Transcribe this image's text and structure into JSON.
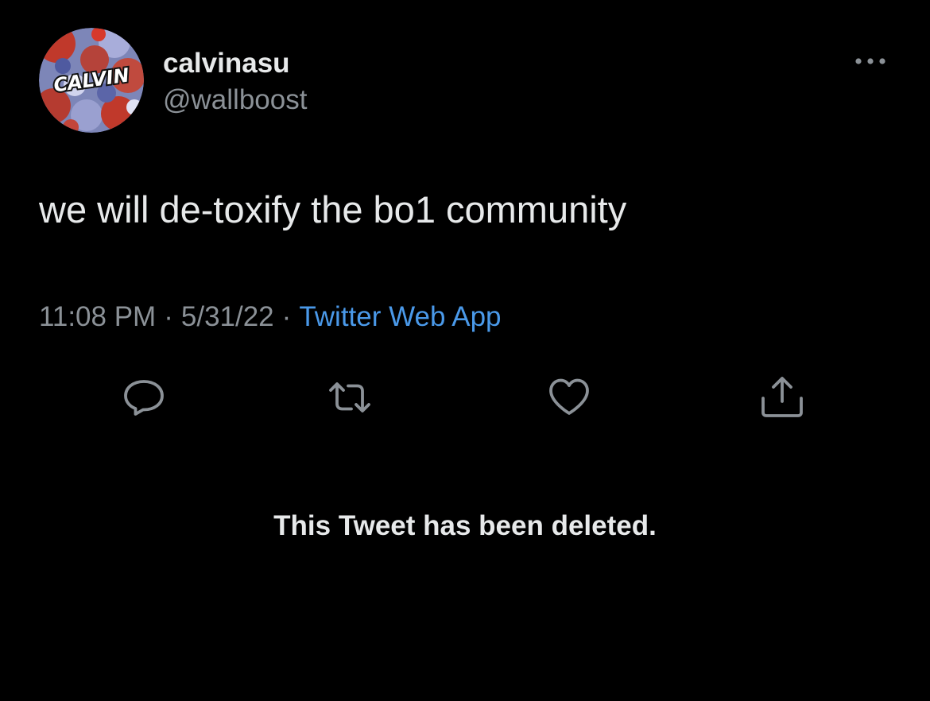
{
  "tweet": {
    "avatar": {
      "icon": "calvin-logo-avatar",
      "logo_text": "CALVIN"
    },
    "display_name": "calvinasu",
    "handle": "@wallboost",
    "text": "we will de-toxify the bo1 community",
    "time": "11:08 PM",
    "date": "5/31/22",
    "separator": "·",
    "source": "Twitter Web App"
  },
  "actions": [
    {
      "name": "reply",
      "icon": "reply-bubble-icon"
    },
    {
      "name": "retweet",
      "icon": "retweet-icon"
    },
    {
      "name": "like",
      "icon": "heart-icon"
    },
    {
      "name": "share",
      "icon": "share-icon"
    }
  ],
  "more_menu": {
    "icon": "more-dots-icon"
  },
  "deleted_notice": "This Tweet has been deleted.",
  "colors": {
    "background": "#000000",
    "primary_text": "#e7e9ea",
    "secondary_text": "#8b9197",
    "link": "#4a99e9"
  }
}
